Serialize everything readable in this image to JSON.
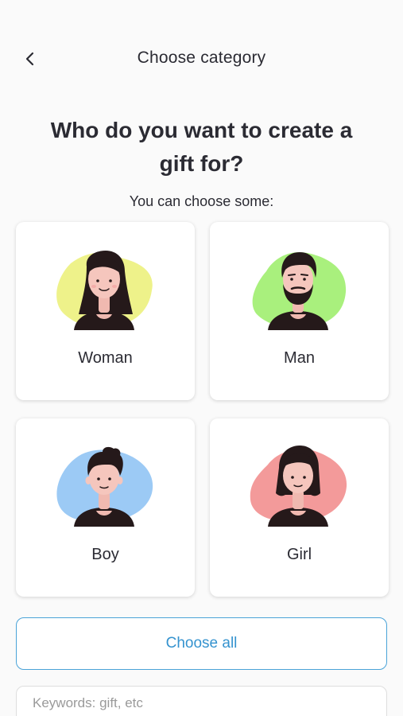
{
  "header": {
    "title": "Choose category",
    "back_icon": "chevron-left-icon"
  },
  "heading": "Who do you want to create a gift for?",
  "subheading": "You can choose some:",
  "categories": [
    {
      "label": "Woman",
      "blob_color": "#eef28a"
    },
    {
      "label": "Man",
      "blob_color": "#a9f07d"
    },
    {
      "label": "Boy",
      "blob_color": "#9ccaf5"
    },
    {
      "label": "Girl",
      "blob_color": "#f39a9a"
    }
  ],
  "choose_all_label": "Choose all",
  "keywords": {
    "placeholder": "Keywords: gift, etc",
    "value": ""
  },
  "colors": {
    "accent": "#3593cf",
    "background": "#fafafa",
    "text": "#2b2b33"
  }
}
